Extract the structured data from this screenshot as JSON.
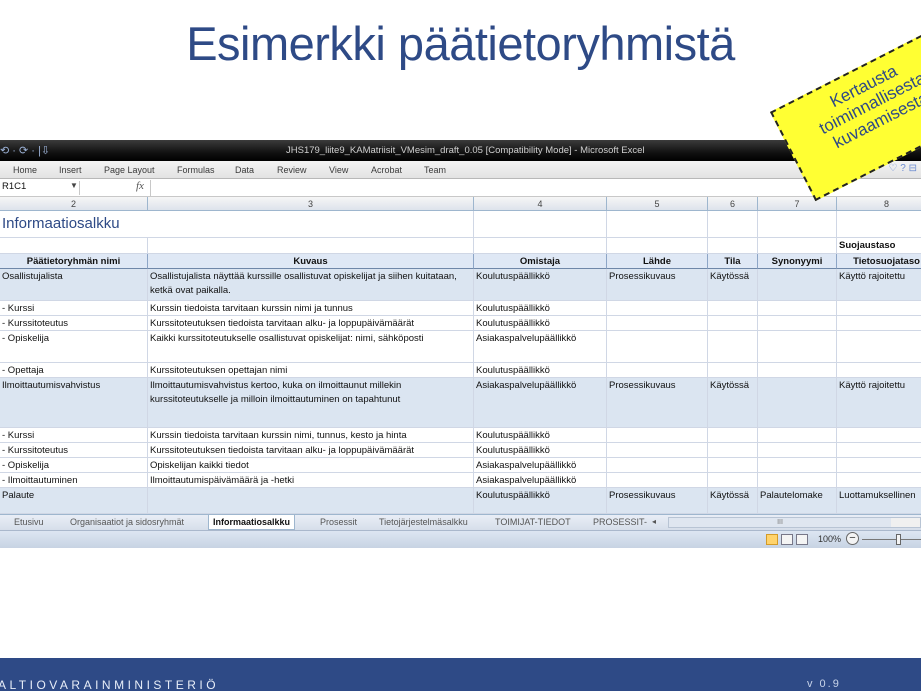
{
  "slide": {
    "title": "Esimerkki päätietoryhmistä",
    "sticky_note": "Kertausta\ntoiminnallisesta\nkuvaamisesta"
  },
  "excel": {
    "qat": "⟲ · ⟳ · |⇩",
    "window_title": "JHS179_liite9_KAMatriisit_VMesim_draft_0.05  [Compatibility Mode]  -  Microsoft Excel",
    "ribbon_tabs": [
      "Home",
      "Insert",
      "Page Layout",
      "Formulas",
      "Data",
      "Review",
      "View",
      "Acrobat",
      "Team"
    ],
    "help": "♡ ? ⊟",
    "name_box": "R1C1",
    "column_headers": [
      "2",
      "3",
      "4",
      "5",
      "6",
      "7",
      "8"
    ],
    "sheet_title": "Informaatiosalkku",
    "extra_header": "Suojaustaso",
    "table_headers": [
      "Päätietoryhmän nimi",
      "Kuvaus",
      "Omistaja",
      "Lähde",
      "Tila",
      "Synonyymi",
      "Tietosuojataso"
    ],
    "rows": [
      [
        "Osallistujalista",
        "Osallistujalista näyttää kurssille osallistuvat opiskelijat ja siihen kuitataan, ketkä ovat paikalla.",
        "Koulutuspäällikkö",
        "Prosessikuvaus",
        "Käytössä",
        "",
        "Käyttö rajoitettu"
      ],
      [
        "- Kurssi",
        "Kurssin tiedoista tarvitaan kurssin nimi ja tunnus",
        "Koulutuspäällikkö",
        "",
        "",
        "",
        ""
      ],
      [
        "- Kurssitoteutus",
        "Kurssitoteutuksen tiedoista tarvitaan alku- ja loppupäivämäärät",
        "Koulutuspäällikkö",
        "",
        "",
        "",
        ""
      ],
      [
        "- Opiskelija",
        "Kaikki kurssitoteutukselle osallistuvat opiskelijat: nimi, sähköposti",
        "Asiakaspalvelupäällikkö",
        "",
        "",
        "",
        ""
      ],
      [
        "- Opettaja",
        "Kurssitoteutuksen opettajan nimi",
        "Koulutuspäällikkö",
        "",
        "",
        "",
        ""
      ],
      [
        "Ilmoittautumisvahvistus",
        "Ilmoittautumisvahvistus kertoo, kuka on ilmoittaunut millekin kurssitoteutukselle ja milloin ilmoittautuminen on tapahtunut",
        "Asiakaspalvelupäällikkö",
        "Prosessikuvaus",
        "Käytössä",
        "",
        "Käyttö rajoitettu"
      ],
      [
        "- Kurssi",
        "Kurssin tiedoista tarvitaan kurssin nimi, tunnus, kesto ja hinta",
        "Koulutuspäällikkö",
        "",
        "",
        "",
        ""
      ],
      [
        "- Kurssitoteutus",
        "Kurssitoteutuksen tiedoista tarvitaan alku- ja loppupäivämäärät",
        "Koulutuspäällikkö",
        "",
        "",
        "",
        ""
      ],
      [
        "- Opiskelija",
        "Opiskelijan kaikki tiedot",
        "Asiakaspalvelupäällikkö",
        "",
        "",
        "",
        ""
      ],
      [
        "- Ilmoittautuminen",
        "Ilmoittautumispäivämäärä ja -hetki",
        "Asiakaspalvelupäällikkö",
        "",
        "",
        "",
        ""
      ],
      [
        "Palaute",
        "",
        "Koulutuspäällikkö",
        "Prosessikuvaus",
        "Käytössä",
        "Palautelomake",
        "Luottamuksellinen"
      ]
    ],
    "sheet_tabs": [
      "Etusivu",
      "Organisaatiot ja sidosryhmät",
      "Informaatiosalkku",
      "Prosessit",
      "Tietojärjestelmäsalkku",
      "TOIMIJAT-TIEDOT",
      "PROSESSIT-"
    ],
    "active_sheet": "Informaatiosalkku",
    "scroll_marker": "III",
    "zoom": "100%"
  },
  "footer": {
    "organization": "ALTIOVARAINMINISTERIÖ",
    "version": "v 0.9"
  }
}
